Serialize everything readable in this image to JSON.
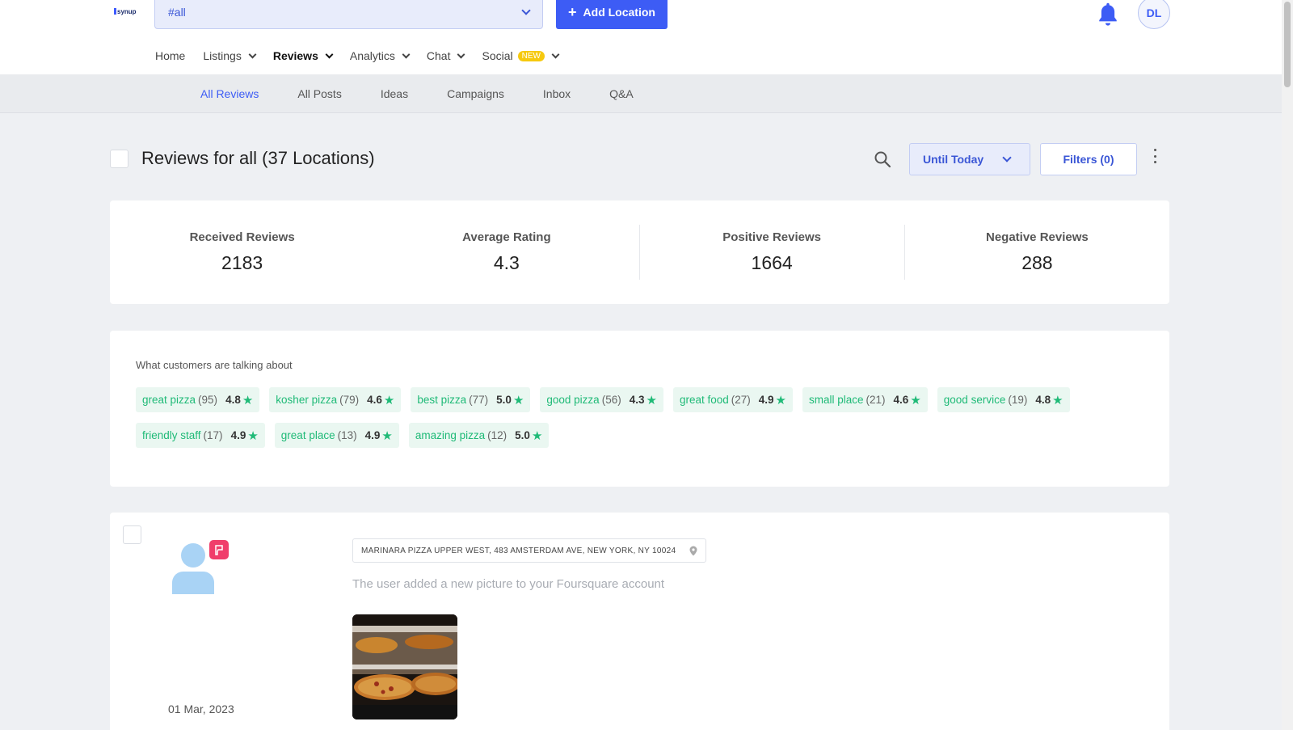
{
  "header": {
    "logo_text": "synup",
    "location_select": {
      "value": "#all"
    },
    "add_location_label": "Add Location",
    "avatar_initials": "DL"
  },
  "main_nav": [
    {
      "label": "Home",
      "has_dropdown": false
    },
    {
      "label": "Listings",
      "has_dropdown": true
    },
    {
      "label": "Reviews",
      "has_dropdown": true,
      "active": true
    },
    {
      "label": "Analytics",
      "has_dropdown": true
    },
    {
      "label": "Chat",
      "has_dropdown": true
    },
    {
      "label": "Social",
      "has_dropdown": true,
      "badge": "NEW"
    }
  ],
  "sub_nav": [
    {
      "label": "All Reviews",
      "active": true
    },
    {
      "label": "All Posts"
    },
    {
      "label": "Ideas"
    },
    {
      "label": "Campaigns"
    },
    {
      "label": "Inbox"
    },
    {
      "label": "Q&A"
    }
  ],
  "page": {
    "title": "Reviews for all (37 Locations)",
    "date_filter": "Until Today",
    "filters_label": "Filters (0)"
  },
  "stats": [
    {
      "label": "Received Reviews",
      "value": "2183"
    },
    {
      "label": "Average Rating",
      "value": "4.3"
    },
    {
      "label": "Positive Reviews",
      "value": "1664"
    },
    {
      "label": "Negative Reviews",
      "value": "288"
    }
  ],
  "topics": {
    "heading": "What customers are talking about",
    "chips": [
      {
        "term": "great pizza",
        "count": "(95)",
        "rating": "4.8"
      },
      {
        "term": "kosher pizza",
        "count": "(79)",
        "rating": "4.6"
      },
      {
        "term": "best pizza",
        "count": "(77)",
        "rating": "5.0"
      },
      {
        "term": "good pizza",
        "count": "(56)",
        "rating": "4.3"
      },
      {
        "term": "great food",
        "count": "(27)",
        "rating": "4.9"
      },
      {
        "term": "small place",
        "count": "(21)",
        "rating": "4.6"
      },
      {
        "term": "good service",
        "count": "(19)",
        "rating": "4.8"
      },
      {
        "term": "friendly staff",
        "count": "(17)",
        "rating": "4.9"
      },
      {
        "term": "great place",
        "count": "(13)",
        "rating": "4.9"
      },
      {
        "term": "amazing pizza",
        "count": "(12)",
        "rating": "5.0"
      }
    ]
  },
  "review": {
    "location": "MARINARA PIZZA UPPER WEST, 483 AMSTERDAM AVE, NEW YORK, NY 10024",
    "text": "The user added a new picture to your Foursquare account",
    "date": "01 Mar, 2023",
    "source_icon": "foursquare-icon"
  },
  "colors": {
    "accent": "#3d5cf5",
    "positive_green": "#1fba77",
    "source_pink": "#f03e6b",
    "badge_yellow": "#f6c90e"
  }
}
